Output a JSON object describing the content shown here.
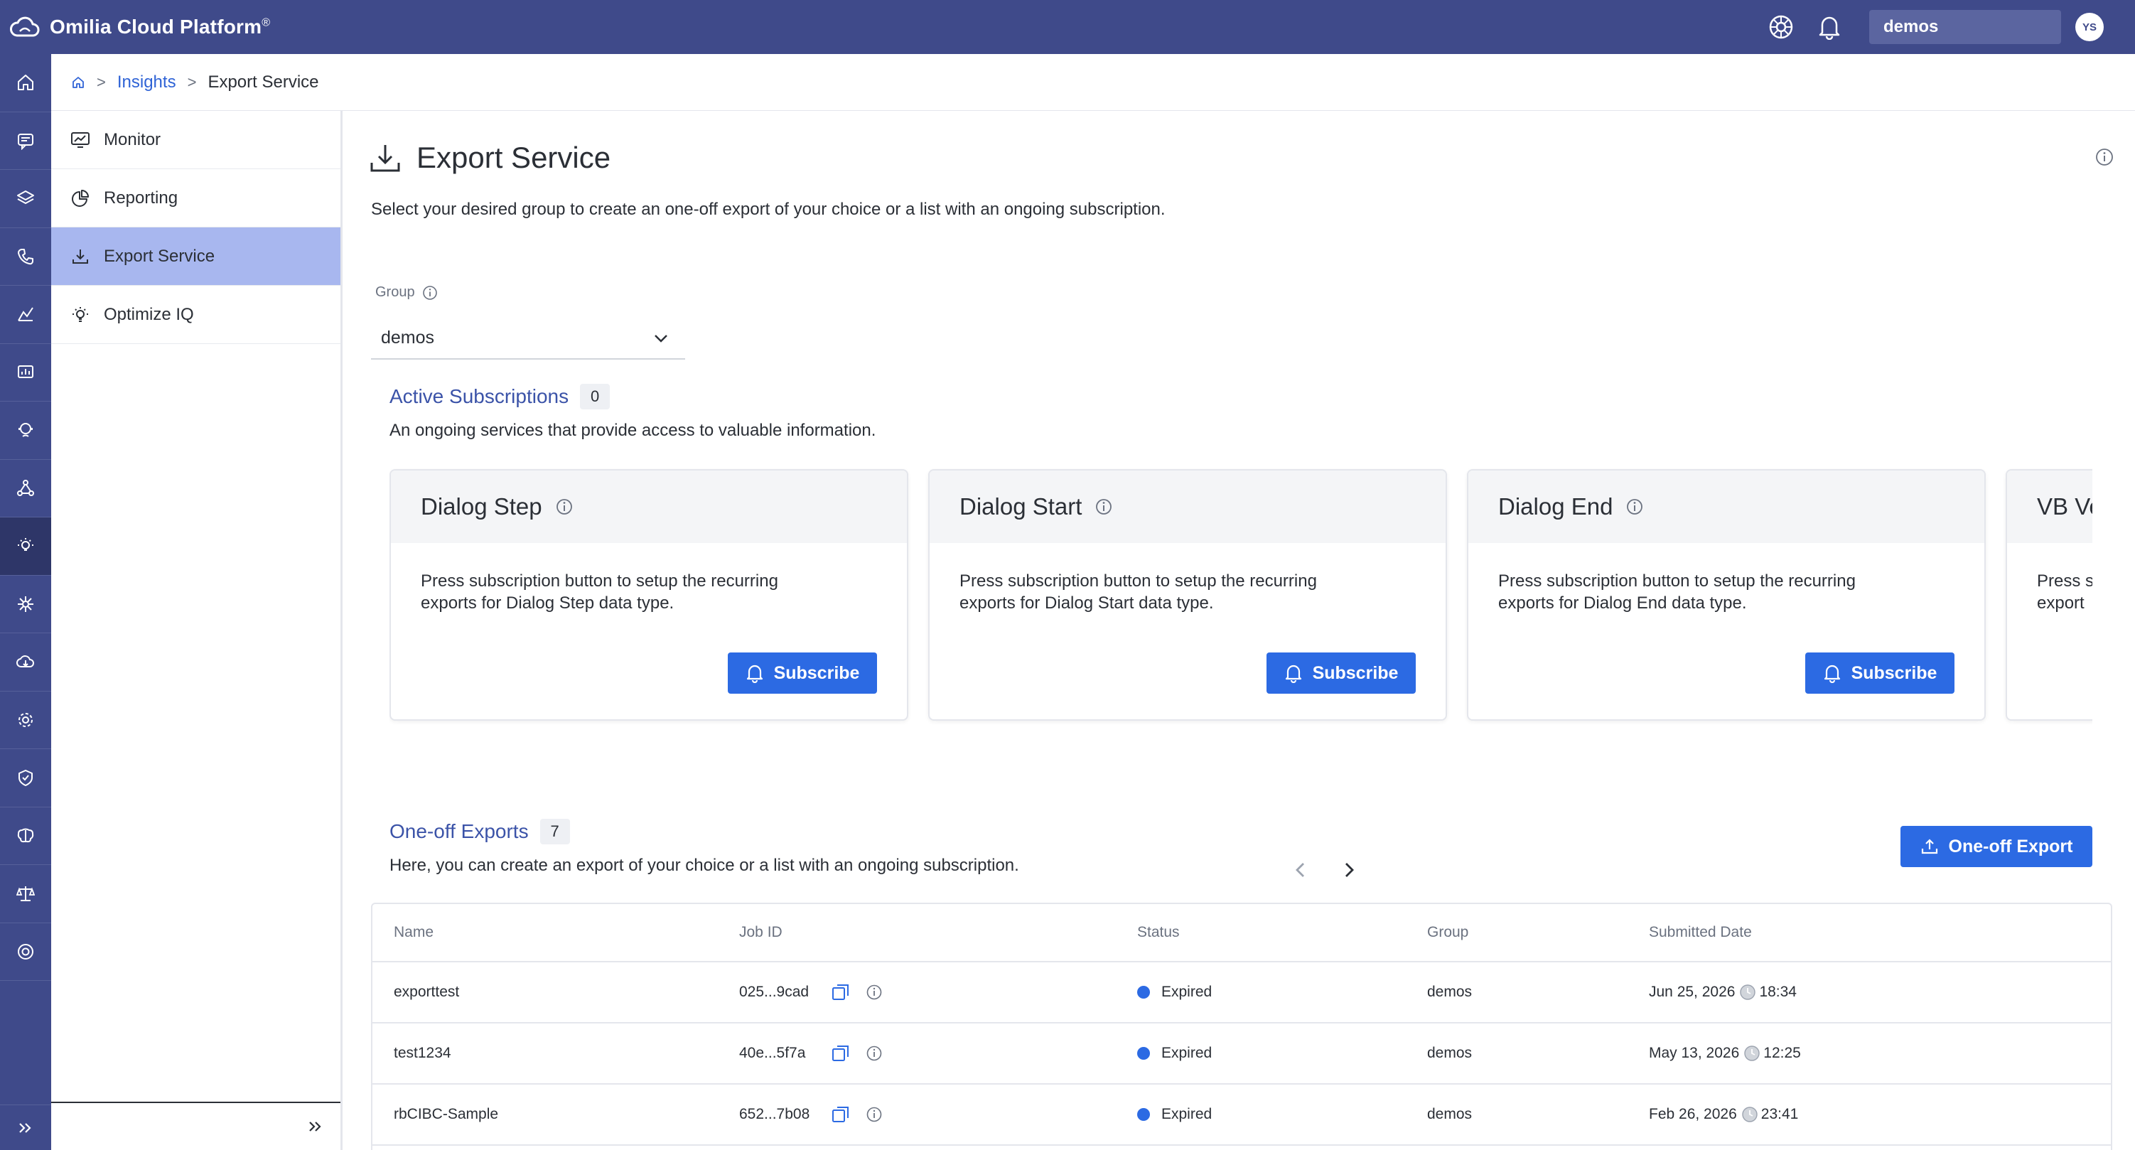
{
  "app": {
    "name": "Omilia Cloud Platform",
    "trademark": "®",
    "organization": "demos",
    "user_initials": "YS"
  },
  "breadcrumb": {
    "home_icon": "home-icon",
    "items": [
      "Insights",
      "Export Service"
    ]
  },
  "sidenav": {
    "items": [
      {
        "label": "Monitor",
        "icon": "monitor-icon",
        "active": false
      },
      {
        "label": "Reporting",
        "icon": "pie-chart-icon",
        "active": false
      },
      {
        "label": "Export Service",
        "icon": "download-icon",
        "active": true
      },
      {
        "label": "Optimize IQ",
        "icon": "lightbulb-icon",
        "active": false
      }
    ],
    "collapse_icon": "double-chevron-right-icon"
  },
  "rail": {
    "items": [
      "home-icon",
      "dialog-icon",
      "layers-icon",
      "phone-icon",
      "analytics-icon",
      "presentation-icon",
      "agent-icon",
      "network-icon",
      "insights-icon",
      "hub-icon",
      "cloud-icon",
      "settings-icon",
      "shield-icon",
      "brain-icon",
      "balance-icon",
      "support-icon"
    ],
    "active_index": 8,
    "expand_icon": "double-chevron-right-icon"
  },
  "page": {
    "title": "Export Service",
    "description": "Select your desired group to create an one-off export of your choice or a list with an ongoing subscription."
  },
  "group": {
    "label": "Group",
    "value": "demos"
  },
  "subscriptions": {
    "title": "Active Subscriptions",
    "count": "0",
    "description": "An ongoing services that provide access to valuable information.",
    "subscribe_label": "Subscribe",
    "cards": [
      {
        "title": "Dialog Step",
        "body": "Press subscription button to setup the recurring exports for Dialog Step data type."
      },
      {
        "title": "Dialog Start",
        "body": "Press subscription button to setup the recurring exports for Dialog Start data type."
      },
      {
        "title": "Dialog End",
        "body": "Press subscription button to setup the recurring exports for Dialog End data type."
      },
      {
        "title": "VB Ve",
        "body": "Press s export"
      }
    ]
  },
  "exports": {
    "title": "One-off Exports",
    "count": "7",
    "description": "Here, you can create an export of your choice or a list with an ongoing subscription.",
    "button_label": "One-off Export",
    "columns": [
      "Name",
      "Job ID",
      "Status",
      "Group",
      "Submitted Date"
    ],
    "rows": [
      {
        "name": "exporttest",
        "job_id": "025...9cad",
        "status": "Expired",
        "group": "demos",
        "date": "Jun 25, 2026",
        "time": "18:34"
      },
      {
        "name": "test1234",
        "job_id": "40e...5f7a",
        "status": "Expired",
        "group": "demos",
        "date": "May 13, 2026",
        "time": "12:25"
      },
      {
        "name": "rbCIBC-Sample",
        "job_id": "652...7b08",
        "status": "Expired",
        "group": "demos",
        "date": "Feb 26, 2026",
        "time": "23:41"
      }
    ]
  },
  "colors": {
    "topbar": "#3f4a8a",
    "accent": "#2c6ae3",
    "active_nav": "#a8b7ef",
    "section_title": "#3b53a8"
  }
}
